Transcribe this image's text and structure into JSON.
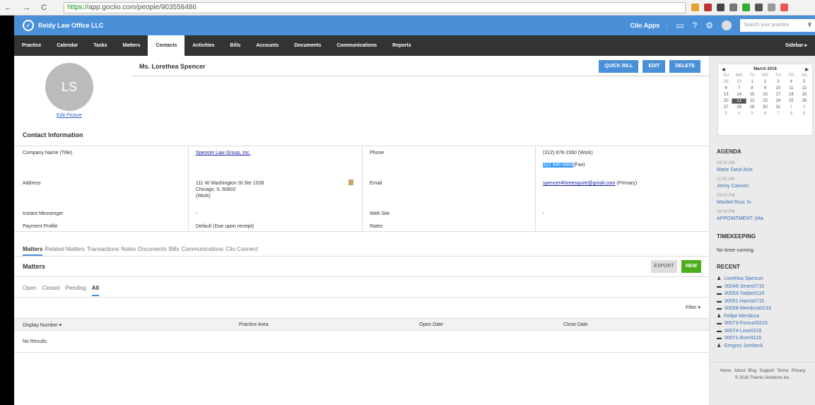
{
  "browser": {
    "url_secure": "https://",
    "url_rest": "app.goclio.com/people/903558486"
  },
  "header": {
    "firm": "Reidy Law Office LLC",
    "apps": "Clio Apps",
    "search_placeholder": "Search your practice"
  },
  "nav": [
    "Practice",
    "Calendar",
    "Tasks",
    "Matters",
    "Contacts",
    "Activities",
    "Bills",
    "Accounts",
    "Documents",
    "Communications",
    "Reports"
  ],
  "nav_sidebar": "Sidebar ▸",
  "contact": {
    "initials": "LS",
    "edit_picture": "Edit Picture",
    "name": "Ms. Lorethea Spencer",
    "quick_bill": "QUICK BILL",
    "edit": "EDIT",
    "delete": "DELETE",
    "section_title": "Contact Information"
  },
  "fields": {
    "company_label": "Company Name (Title)",
    "company": "Spencer Law Group, Inc.",
    "address_label": "Address",
    "address1": "111 W Washington St Ste 1028",
    "address2": "Chicago, IL 60602",
    "address3": "(Work)",
    "im_label": "Instant Messenger",
    "im": "-",
    "payment_label": "Payment Profile",
    "payment": "Default (Due upon receipt)",
    "phone_label": "Phone",
    "phone_work": "(312) 878-1560 (Work)",
    "phone_fax": "312 940-5806",
    "fax_suffix": "(Fax)",
    "email_label": "Email",
    "email": "spencer4hireesquire@gmail.com",
    "email_suffix": " (Primary)",
    "web_label": "Web Site",
    "web": "-",
    "rates_label": "Rates"
  },
  "tabs": [
    "Matters",
    "Related Matters",
    "Transactions",
    "Notes",
    "Documents",
    "Bills",
    "Communications",
    "Clio Connect"
  ],
  "matters": {
    "title": "Matters",
    "export": "EXPORT",
    "new": "NEW",
    "subtabs": [
      "Open",
      "Closed",
      "Pending",
      "All"
    ],
    "filter": "Filter ▾",
    "columns": [
      "Display Number ▾",
      "Practice Area",
      "Open Date",
      "Close Date"
    ],
    "empty": "No Results"
  },
  "calendar": {
    "month": "March 2016",
    "days": [
      "SU",
      "MO",
      "TU",
      "WE",
      "TH",
      "FR",
      "SA"
    ],
    "dates": [
      "28",
      "29",
      "1",
      "2",
      "3",
      "4",
      "5",
      "6",
      "7",
      "8",
      "9",
      "10",
      "11",
      "12",
      "13",
      "14",
      "15",
      "16",
      "17",
      "18",
      "19",
      "20",
      "21",
      "22",
      "23",
      "24",
      "25",
      "26",
      "27",
      "28",
      "29",
      "30",
      "31",
      "1",
      "2",
      "3",
      "4",
      "5",
      "6",
      "7",
      "8",
      "9"
    ],
    "today": "21"
  },
  "agenda": {
    "title": "AGENDA",
    "items": [
      {
        "time": "08:00 AM",
        "name": "Marie Daryl Asis"
      },
      {
        "time": "11:30 AM",
        "name": "Jenny Cannon"
      },
      {
        "time": "05:00 PM",
        "name": "Maribel Rica: In"
      },
      {
        "time": "06:00 PM",
        "name": "APPOINTMENT: (Ma"
      }
    ]
  },
  "timekeeping": {
    "title": "TIMEKEEPING",
    "status": "No timer running."
  },
  "recent": {
    "title": "RECENT",
    "items": [
      {
        "type": "person",
        "label": "Lorethea Spencer"
      },
      {
        "type": "matter",
        "label": "00049-Jones0715"
      },
      {
        "type": "matter",
        "label": "00053-Yadav0116"
      },
      {
        "type": "matter",
        "label": "00051-Harris0715"
      },
      {
        "type": "matter",
        "label": "00058-Mendoza0216"
      },
      {
        "type": "person",
        "label": "Felipe Mendoza"
      },
      {
        "type": "matter",
        "label": "00073-Forouzi0216"
      },
      {
        "type": "matter",
        "label": "00074-Love0216"
      },
      {
        "type": "matter",
        "label": "00071-Boer0216"
      },
      {
        "type": "person",
        "label": "Gregory Jumbeck"
      }
    ]
  },
  "footer": {
    "links": [
      "Home",
      "About",
      "Blog",
      "Support",
      "Terms",
      "Privacy"
    ],
    "copyright": "© 2016 Themis Solutions Inc."
  }
}
